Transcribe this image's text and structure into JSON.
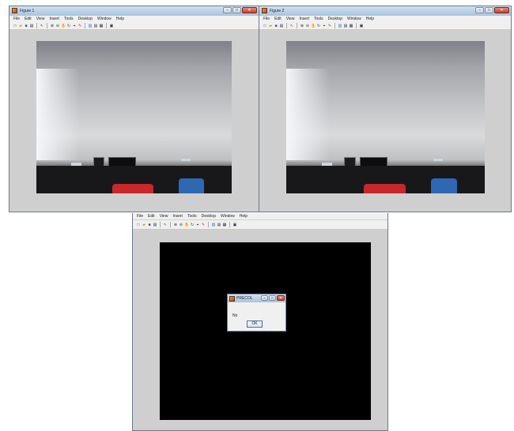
{
  "window1": {
    "title": "Figure 1"
  },
  "window2": {
    "title": "Figure 2"
  },
  "window3": {
    "title": ""
  },
  "menu": [
    "File",
    "Edit",
    "View",
    "Insert",
    "Tools",
    "Desktop",
    "Window",
    "Help"
  ],
  "window_controls": {
    "minimize": "–",
    "maximize": "□",
    "close": "✕"
  },
  "toolbar_icons": [
    "new-file-icon",
    "open-folder-icon",
    "save-icon",
    "print-icon",
    "pointer-icon",
    "zoom-in-icon",
    "zoom-out-icon",
    "pan-icon",
    "rotate-icon",
    "data-cursor-icon",
    "brush-icon",
    "colorbar-icon",
    "legend-icon",
    "hide-tools-icon",
    "show-tools-icon"
  ],
  "dialog": {
    "title": "PRECOL",
    "message": "No",
    "ok_label": "OK"
  },
  "colors": {
    "title_bar": "#b9cde3",
    "close_button": "#c2412a",
    "canvas": "#cfcfcf"
  }
}
